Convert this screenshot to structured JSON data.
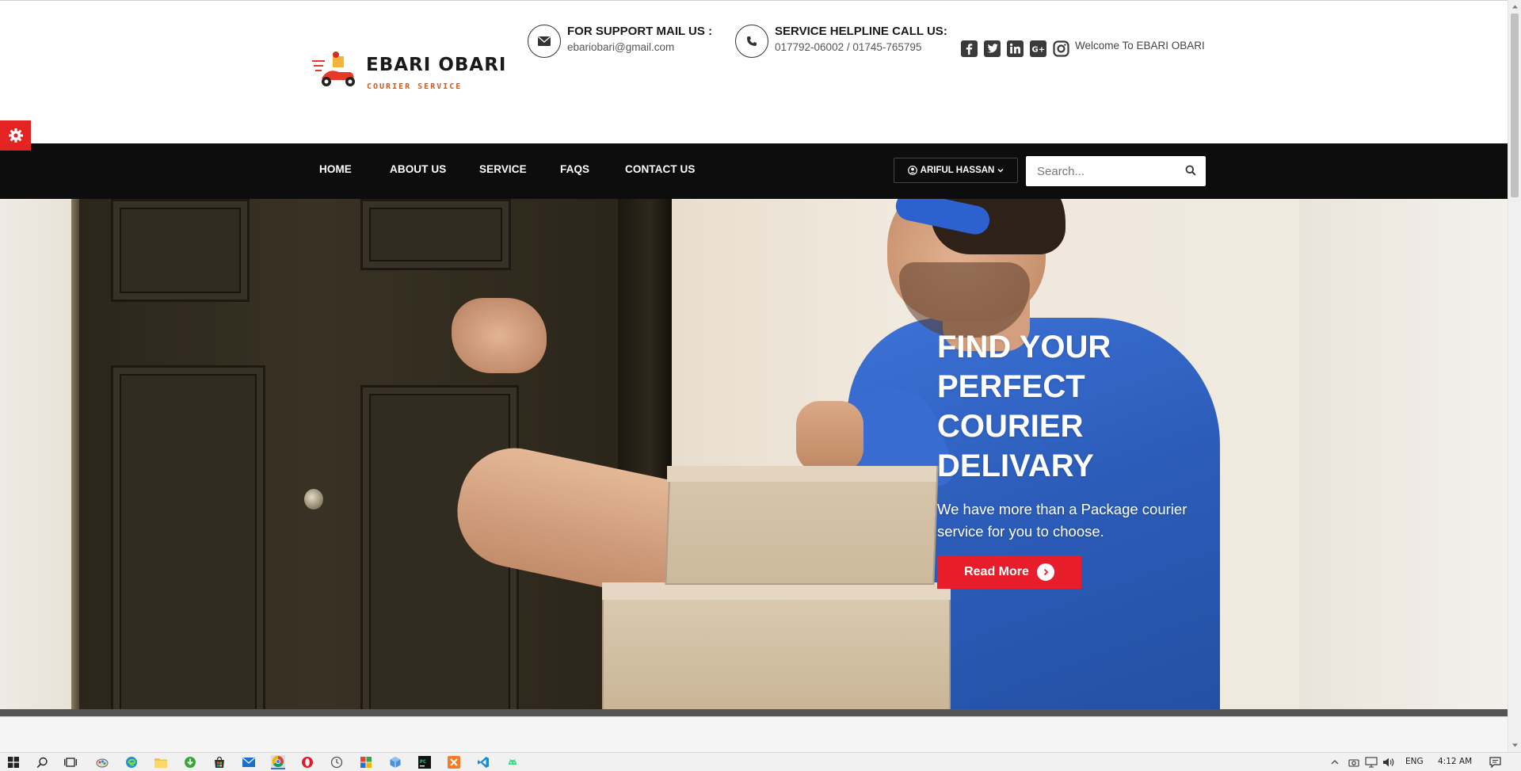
{
  "brand": {
    "title": "EBARI OBARI",
    "subtitle": "COURIER SERVICE"
  },
  "header": {
    "mail": {
      "title": "FOR SUPPORT MAIL US :",
      "value": "ebariobari@gmail.com",
      "icon": "envelope-icon"
    },
    "phone": {
      "title": "SERVICE HELPLINE CALL US:",
      "value": "017792-06002 / 01745-765795",
      "icon": "phone-icon"
    },
    "socials": [
      "facebook-icon",
      "twitter-icon",
      "linkedin-icon",
      "google-plus-icon",
      "instagram-icon"
    ],
    "welcome": "Welcome To EBARI OBARI"
  },
  "nav": {
    "items": [
      "HOME",
      "ABOUT US",
      "SERVICE",
      "FAQS",
      "CONTACT US"
    ],
    "user": "ARIFUL HASSAN",
    "search_placeholder": "Search..."
  },
  "hero": {
    "title_lines": [
      "FIND YOUR",
      "PERFECT",
      "COURIER",
      "DELIVARY"
    ],
    "subtitle": "We have more than a Package courier service for you to choose.",
    "button": "Read More"
  },
  "taskbar": {
    "language": "ENG",
    "time": "4:12 AM"
  },
  "colors": {
    "accent": "#e71d2c",
    "navbar": "#0d0d0d",
    "settings_tab": "#e42323"
  }
}
